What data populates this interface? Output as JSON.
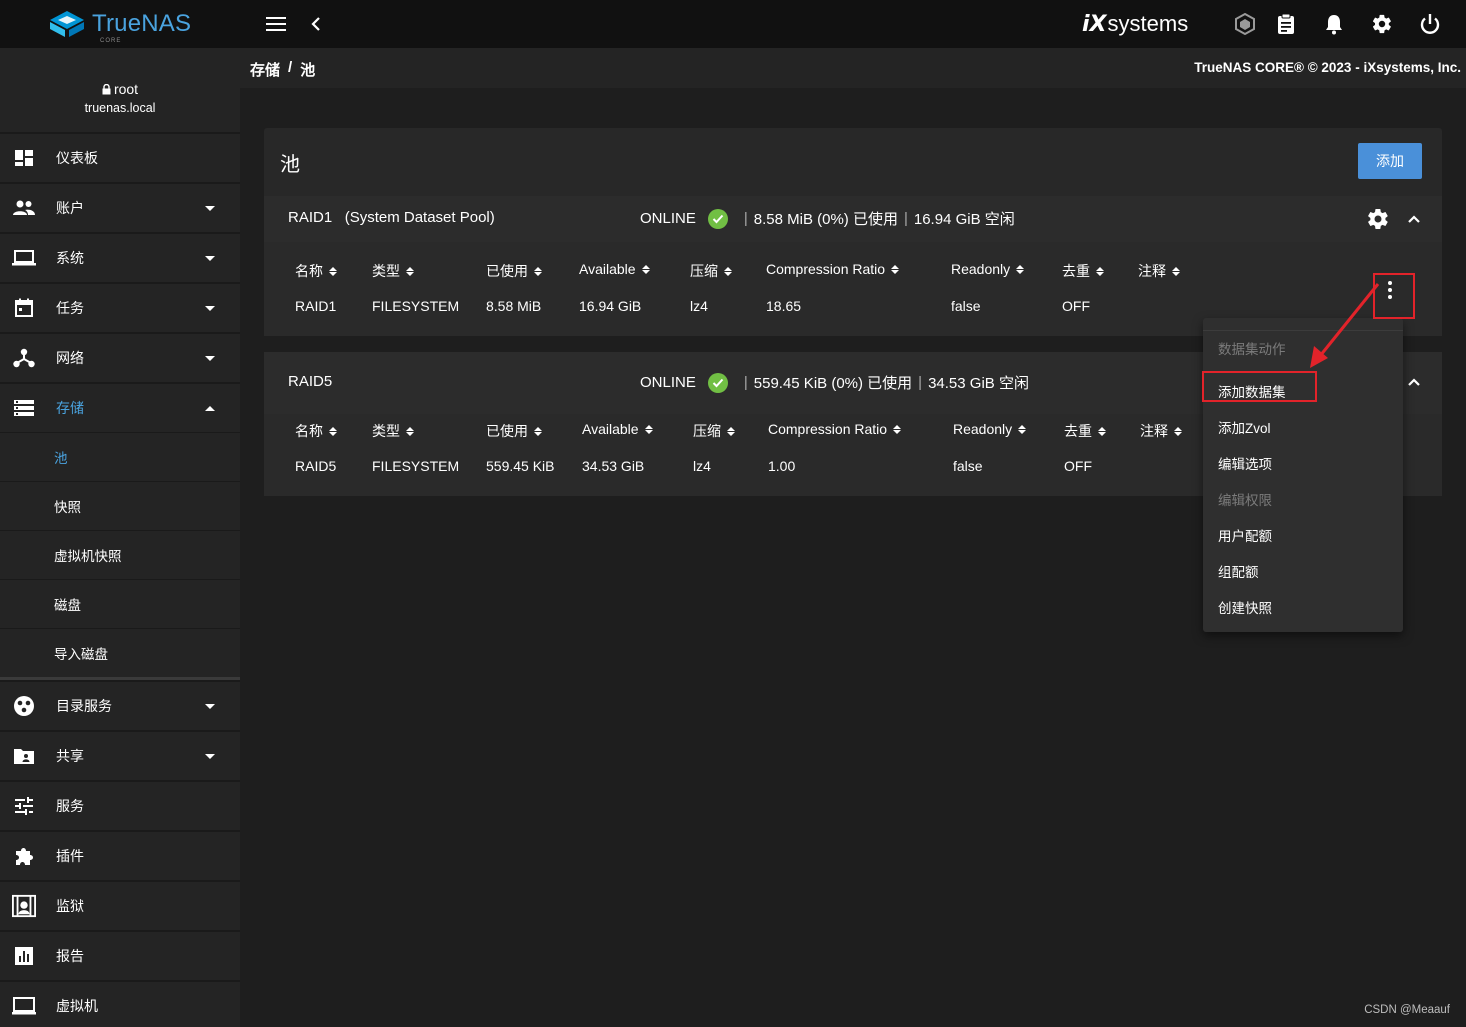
{
  "app": {
    "logo_text": "TrueNAS",
    "logo_sub": "CORE",
    "vendor_brand_ix": "iX",
    "vendor_brand_systems": "systems",
    "accent_color": "#4aa3df",
    "add_button_color": "#4a90d9",
    "online_color": "#71bf44"
  },
  "topbar_icons": [
    "menu-icon",
    "chevron-left-icon",
    "truecommand-icon",
    "clipboard-icon",
    "bell-icon",
    "gear-icon",
    "power-icon"
  ],
  "breadcrumb": {
    "parent": "存储",
    "separator": "/",
    "current": "池"
  },
  "copyright": "TrueNAS CORE® © 2023 - iXsystems, Inc.",
  "user": {
    "name": "root",
    "host": "truenas.local"
  },
  "sidebar": {
    "items": [
      {
        "label": "仪表板",
        "icon": "dashboard-icon"
      },
      {
        "label": "账户",
        "icon": "people-icon"
      },
      {
        "label": "系统",
        "icon": "laptop-icon"
      },
      {
        "label": "任务",
        "icon": "calendar-icon"
      },
      {
        "label": "网络",
        "icon": "network-icon"
      },
      {
        "label": "存储",
        "icon": "storage-icon"
      }
    ],
    "storage_sub": [
      {
        "label": "池"
      },
      {
        "label": "快照"
      },
      {
        "label": "虚拟机快照"
      },
      {
        "label": "磁盘"
      },
      {
        "label": "导入磁盘"
      }
    ],
    "items2": [
      {
        "label": "目录服务",
        "icon": "directory-icon"
      },
      {
        "label": "共享",
        "icon": "share-folder-icon"
      },
      {
        "label": "服务",
        "icon": "tune-icon"
      },
      {
        "label": "插件",
        "icon": "puzzle-icon"
      },
      {
        "label": "监狱",
        "icon": "jail-icon"
      },
      {
        "label": "报告",
        "icon": "chart-icon"
      },
      {
        "label": "虚拟机",
        "icon": "monitor-icon"
      }
    ]
  },
  "main": {
    "title": "池",
    "add_label": "添加",
    "columns": [
      "名称",
      "类型",
      "已使用",
      "Available",
      "压缩",
      "Compression Ratio",
      "Readonly",
      "去重",
      "注释"
    ],
    "pools": [
      {
        "name": "RAID1",
        "tag": "(System Dataset Pool)",
        "status": "ONLINE",
        "used": "8.58 MiB (0%) 已使用",
        "free": "16.94 GiB 空闲",
        "row": [
          "RAID1",
          "FILESYSTEM",
          "8.58 MiB",
          "16.94 GiB",
          "lz4",
          "18.65",
          "false",
          "OFF",
          ""
        ]
      },
      {
        "name": "RAID5",
        "tag": "",
        "status": "ONLINE",
        "used": "559.45 KiB (0%) 已使用",
        "free": "34.53 GiB 空闲",
        "row": [
          "RAID5",
          "FILESYSTEM",
          "559.45 KiB",
          "34.53 GiB",
          "lz4",
          "1.00",
          "false",
          "OFF",
          ""
        ]
      }
    ]
  },
  "menu": {
    "header": "数据集动作",
    "items": [
      "添加数据集",
      "添加Zvol",
      "编辑选项",
      "编辑权限",
      "用户配额",
      "组配额",
      "创建快照"
    ]
  },
  "watermark": "CSDN @Meaauf"
}
